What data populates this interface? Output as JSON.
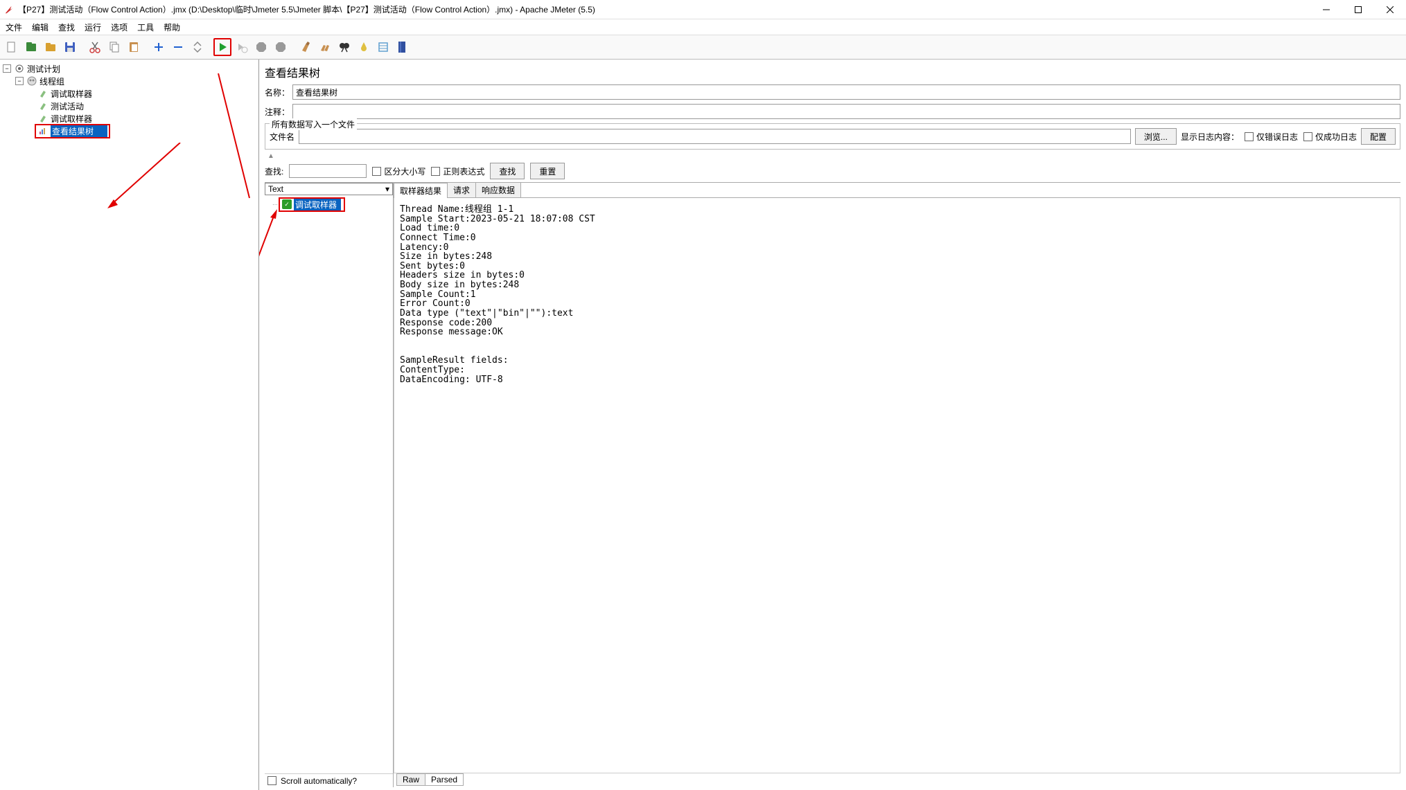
{
  "window": {
    "title": "【P27】测试活动（Flow Control Action）.jmx (D:\\Desktop\\临时\\Jmeter 5.5\\Jmeter 脚本\\【P27】测试活动（Flow Control Action）.jmx) - Apache JMeter (5.5)"
  },
  "menu": {
    "file": "文件",
    "edit": "编辑",
    "search": "查找",
    "run": "运行",
    "options": "选项",
    "tools": "工具",
    "help": "帮助"
  },
  "tree": {
    "root": "测试计划",
    "thread_group": "线程组",
    "items": [
      "调试取样器",
      "测试活动",
      "调试取样器",
      "查看结果树"
    ],
    "selected_index": 3
  },
  "panel": {
    "title": "查看结果树",
    "name_label": "名称：",
    "name_value": "查看结果树",
    "comment_label": "注释：",
    "comment_value": "",
    "file_section": "所有数据写入一个文件",
    "file_label": "文件名",
    "browse": "浏览...",
    "log_show": "显示日志内容：",
    "only_error": "仅错误日志",
    "only_success": "仅成功日志",
    "configure": "配置",
    "search_label": "查找:",
    "case_sensitive": "区分大小写",
    "regex": "正则表达式",
    "search_btn": "查找",
    "reset_btn": "重置"
  },
  "results": {
    "renderer": "Text",
    "sample_name": "调试取样器",
    "scroll_auto": "Scroll automatically?",
    "tabs": {
      "sampler": "取样器结果",
      "request": "请求",
      "response": "响应数据"
    },
    "bottom_tabs": {
      "raw": "Raw",
      "parsed": "Parsed"
    },
    "detail": "Thread Name:线程组 1-1\nSample Start:2023-05-21 18:07:08 CST\nLoad time:0\nConnect Time:0\nLatency:0\nSize in bytes:248\nSent bytes:0\nHeaders size in bytes:0\nBody size in bytes:248\nSample Count:1\nError Count:0\nData type (\"text\"|\"bin\"|\"\"):text\nResponse code:200\nResponse message:OK\n\n\nSampleResult fields:\nContentType:\nDataEncoding: UTF-8"
  }
}
